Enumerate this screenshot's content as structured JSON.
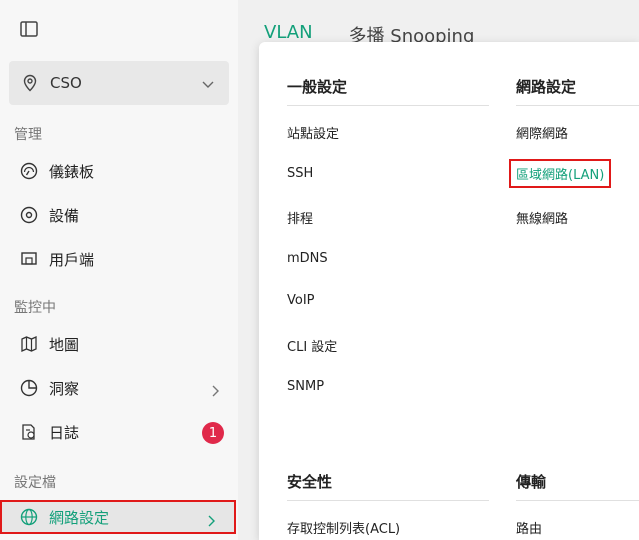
{
  "sidebar": {
    "site": "CSO",
    "sections": {
      "manage": "管理",
      "monitor": "監控中",
      "config": "設定檔"
    },
    "items": [
      {
        "label": "儀錶板",
        "icon": "dashboard-icon"
      },
      {
        "label": "設備",
        "icon": "device-icon"
      },
      {
        "label": "用戶端",
        "icon": "client-icon"
      },
      {
        "label": "地圖",
        "icon": "map-icon"
      },
      {
        "label": "洞察",
        "icon": "insight-icon"
      },
      {
        "label": "日誌",
        "icon": "log-icon",
        "badge": "1"
      },
      {
        "label": "網路設定",
        "icon": "globe-icon"
      }
    ]
  },
  "tabs": [
    {
      "label": "VLAN",
      "active": true
    },
    {
      "label": "多播 Snooping",
      "active": false
    }
  ],
  "menu": {
    "general": {
      "title": "一般設定",
      "links": [
        "站點設定",
        "SSH",
        "排程",
        "mDNS",
        "VoIP",
        "CLI 設定",
        "SNMP"
      ]
    },
    "network": {
      "title": "網路設定",
      "links": [
        "網際網路",
        "區域網路(LAN)",
        "無線網路"
      ]
    },
    "security": {
      "title": "安全性",
      "links": [
        "存取控制列表(ACL)"
      ]
    },
    "transport": {
      "title": "傳輸",
      "links": [
        "路由"
      ]
    }
  },
  "colors": {
    "accent": "#13a07a",
    "highlight": "#e01919",
    "badge": "#e0294a"
  }
}
